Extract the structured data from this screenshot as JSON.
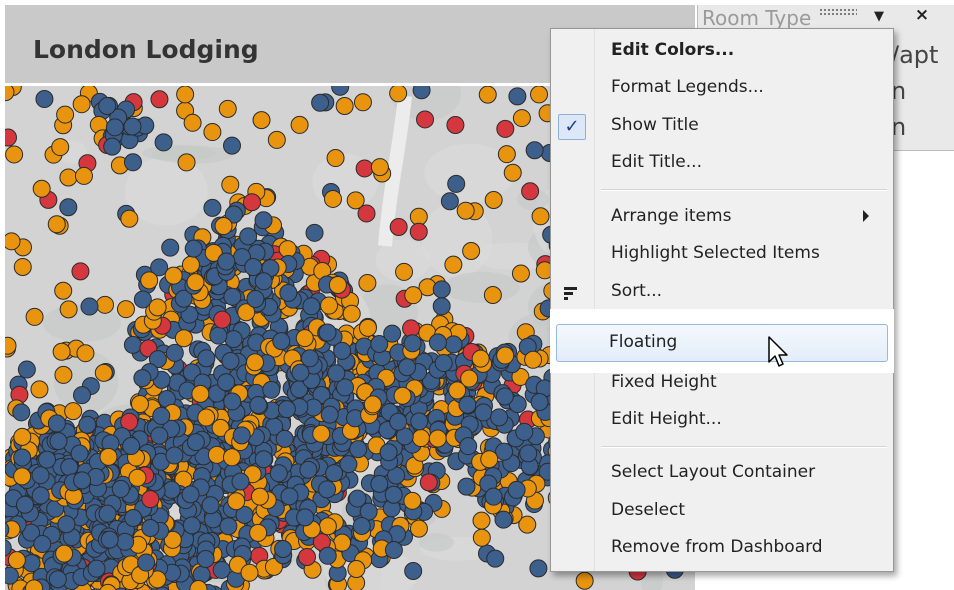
{
  "dashboard": {
    "title": "London Lodging"
  },
  "legend": {
    "title": "Room Type",
    "items": [
      "/apt",
      "n",
      "n"
    ]
  },
  "colors": {
    "orange": "#e8940f",
    "blue": "#3d5f8c",
    "red": "#d4383e",
    "map_bg": "#d3d3d3",
    "menu_bg": "#f0f0f0",
    "check_color": "#1f3e87"
  },
  "icons": {
    "legend_dropdown": "chevron-down-icon",
    "legend_close": "close-icon",
    "check": "checkmark-icon",
    "sort": "sort-icon",
    "submenu": "submenu-arrow-icon",
    "cursor": "mouse-cursor-icon"
  },
  "context_menu": {
    "items": [
      {
        "label": "Edit Colors...",
        "bold": true
      },
      {
        "label": "Format Legends..."
      },
      {
        "label": "Show Title",
        "checked": true
      },
      {
        "label": "Edit Title..."
      },
      {
        "label": "Arrange items",
        "submenu": true
      },
      {
        "label": "Highlight Selected Items"
      },
      {
        "label": "Sort..."
      },
      {
        "label": "Floating",
        "highlighted": true
      },
      {
        "label": "Fixed Height"
      },
      {
        "label": "Edit Height..."
      },
      {
        "label": "Select Layout Container"
      },
      {
        "label": "Deselect"
      },
      {
        "label": "Remove from Dashboard"
      }
    ]
  }
}
